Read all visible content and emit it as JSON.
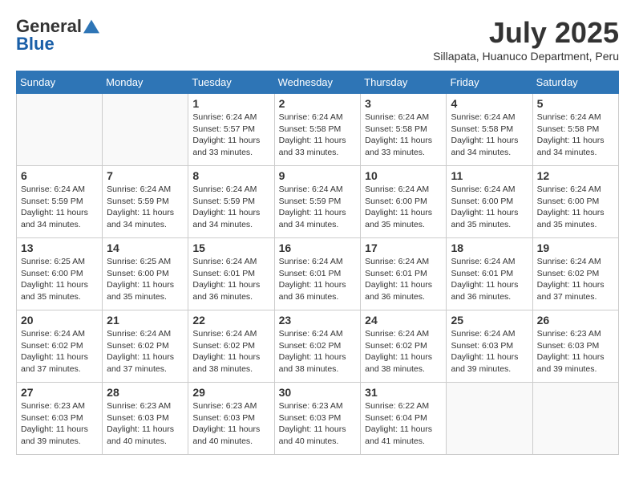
{
  "logo": {
    "general": "General",
    "blue": "Blue"
  },
  "title": "July 2025",
  "location": "Sillapata, Huanuco Department, Peru",
  "days_header": [
    "Sunday",
    "Monday",
    "Tuesday",
    "Wednesday",
    "Thursday",
    "Friday",
    "Saturday"
  ],
  "weeks": [
    [
      {
        "day": "",
        "info": ""
      },
      {
        "day": "",
        "info": ""
      },
      {
        "day": "1",
        "info": "Sunrise: 6:24 AM\nSunset: 5:57 PM\nDaylight: 11 hours and 33 minutes."
      },
      {
        "day": "2",
        "info": "Sunrise: 6:24 AM\nSunset: 5:58 PM\nDaylight: 11 hours and 33 minutes."
      },
      {
        "day": "3",
        "info": "Sunrise: 6:24 AM\nSunset: 5:58 PM\nDaylight: 11 hours and 33 minutes."
      },
      {
        "day": "4",
        "info": "Sunrise: 6:24 AM\nSunset: 5:58 PM\nDaylight: 11 hours and 34 minutes."
      },
      {
        "day": "5",
        "info": "Sunrise: 6:24 AM\nSunset: 5:58 PM\nDaylight: 11 hours and 34 minutes."
      }
    ],
    [
      {
        "day": "6",
        "info": "Sunrise: 6:24 AM\nSunset: 5:59 PM\nDaylight: 11 hours and 34 minutes."
      },
      {
        "day": "7",
        "info": "Sunrise: 6:24 AM\nSunset: 5:59 PM\nDaylight: 11 hours and 34 minutes."
      },
      {
        "day": "8",
        "info": "Sunrise: 6:24 AM\nSunset: 5:59 PM\nDaylight: 11 hours and 34 minutes."
      },
      {
        "day": "9",
        "info": "Sunrise: 6:24 AM\nSunset: 5:59 PM\nDaylight: 11 hours and 34 minutes."
      },
      {
        "day": "10",
        "info": "Sunrise: 6:24 AM\nSunset: 6:00 PM\nDaylight: 11 hours and 35 minutes."
      },
      {
        "day": "11",
        "info": "Sunrise: 6:24 AM\nSunset: 6:00 PM\nDaylight: 11 hours and 35 minutes."
      },
      {
        "day": "12",
        "info": "Sunrise: 6:24 AM\nSunset: 6:00 PM\nDaylight: 11 hours and 35 minutes."
      }
    ],
    [
      {
        "day": "13",
        "info": "Sunrise: 6:25 AM\nSunset: 6:00 PM\nDaylight: 11 hours and 35 minutes."
      },
      {
        "day": "14",
        "info": "Sunrise: 6:25 AM\nSunset: 6:00 PM\nDaylight: 11 hours and 35 minutes."
      },
      {
        "day": "15",
        "info": "Sunrise: 6:24 AM\nSunset: 6:01 PM\nDaylight: 11 hours and 36 minutes."
      },
      {
        "day": "16",
        "info": "Sunrise: 6:24 AM\nSunset: 6:01 PM\nDaylight: 11 hours and 36 minutes."
      },
      {
        "day": "17",
        "info": "Sunrise: 6:24 AM\nSunset: 6:01 PM\nDaylight: 11 hours and 36 minutes."
      },
      {
        "day": "18",
        "info": "Sunrise: 6:24 AM\nSunset: 6:01 PM\nDaylight: 11 hours and 36 minutes."
      },
      {
        "day": "19",
        "info": "Sunrise: 6:24 AM\nSunset: 6:02 PM\nDaylight: 11 hours and 37 minutes."
      }
    ],
    [
      {
        "day": "20",
        "info": "Sunrise: 6:24 AM\nSunset: 6:02 PM\nDaylight: 11 hours and 37 minutes."
      },
      {
        "day": "21",
        "info": "Sunrise: 6:24 AM\nSunset: 6:02 PM\nDaylight: 11 hours and 37 minutes."
      },
      {
        "day": "22",
        "info": "Sunrise: 6:24 AM\nSunset: 6:02 PM\nDaylight: 11 hours and 38 minutes."
      },
      {
        "day": "23",
        "info": "Sunrise: 6:24 AM\nSunset: 6:02 PM\nDaylight: 11 hours and 38 minutes."
      },
      {
        "day": "24",
        "info": "Sunrise: 6:24 AM\nSunset: 6:02 PM\nDaylight: 11 hours and 38 minutes."
      },
      {
        "day": "25",
        "info": "Sunrise: 6:24 AM\nSunset: 6:03 PM\nDaylight: 11 hours and 39 minutes."
      },
      {
        "day": "26",
        "info": "Sunrise: 6:23 AM\nSunset: 6:03 PM\nDaylight: 11 hours and 39 minutes."
      }
    ],
    [
      {
        "day": "27",
        "info": "Sunrise: 6:23 AM\nSunset: 6:03 PM\nDaylight: 11 hours and 39 minutes."
      },
      {
        "day": "28",
        "info": "Sunrise: 6:23 AM\nSunset: 6:03 PM\nDaylight: 11 hours and 40 minutes."
      },
      {
        "day": "29",
        "info": "Sunrise: 6:23 AM\nSunset: 6:03 PM\nDaylight: 11 hours and 40 minutes."
      },
      {
        "day": "30",
        "info": "Sunrise: 6:23 AM\nSunset: 6:03 PM\nDaylight: 11 hours and 40 minutes."
      },
      {
        "day": "31",
        "info": "Sunrise: 6:22 AM\nSunset: 6:04 PM\nDaylight: 11 hours and 41 minutes."
      },
      {
        "day": "",
        "info": ""
      },
      {
        "day": "",
        "info": ""
      }
    ]
  ]
}
